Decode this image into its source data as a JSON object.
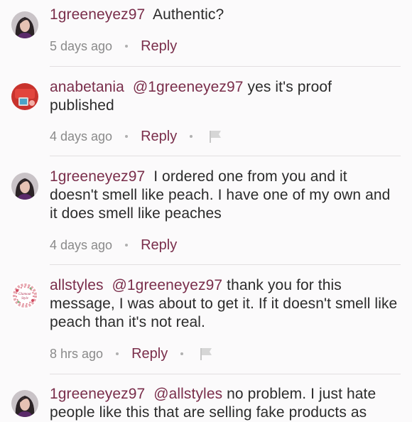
{
  "comments": [
    {
      "username": "1greeneyez97",
      "mention": "",
      "text": "Authentic?",
      "time": "5 days ago",
      "reply": "Reply",
      "flag": false,
      "avatar": "woman-portrait"
    },
    {
      "username": "anabetania",
      "mention": "@1greeneyez97",
      "text": "yes it's proof published",
      "time": "4 days ago",
      "reply": "Reply",
      "flag": true,
      "avatar": "red-product-photo"
    },
    {
      "username": "1greeneyez97",
      "mention": "",
      "text": "I ordered one from you and it doesn't smell like peach. I have one of my own and it does smell like peaches",
      "time": "4 days ago",
      "reply": "Reply",
      "flag": false,
      "avatar": "woman-portrait"
    },
    {
      "username": "allstyles",
      "mention": "@1greeneyez97",
      "text": "thank you for this message, I was about to get it. If it doesn't smell like peach than it's not real.",
      "time": "8 hrs ago",
      "reply": "Reply",
      "flag": true,
      "avatar": "floral-wreath-logo",
      "avatar_text": "Glamour Style"
    },
    {
      "username": "1greeneyez97",
      "mention": "@allstyles",
      "text": "no problem. I just hate people like this that are selling fake products as",
      "time": "",
      "reply": "",
      "flag": false,
      "avatar": "woman-portrait"
    }
  ]
}
